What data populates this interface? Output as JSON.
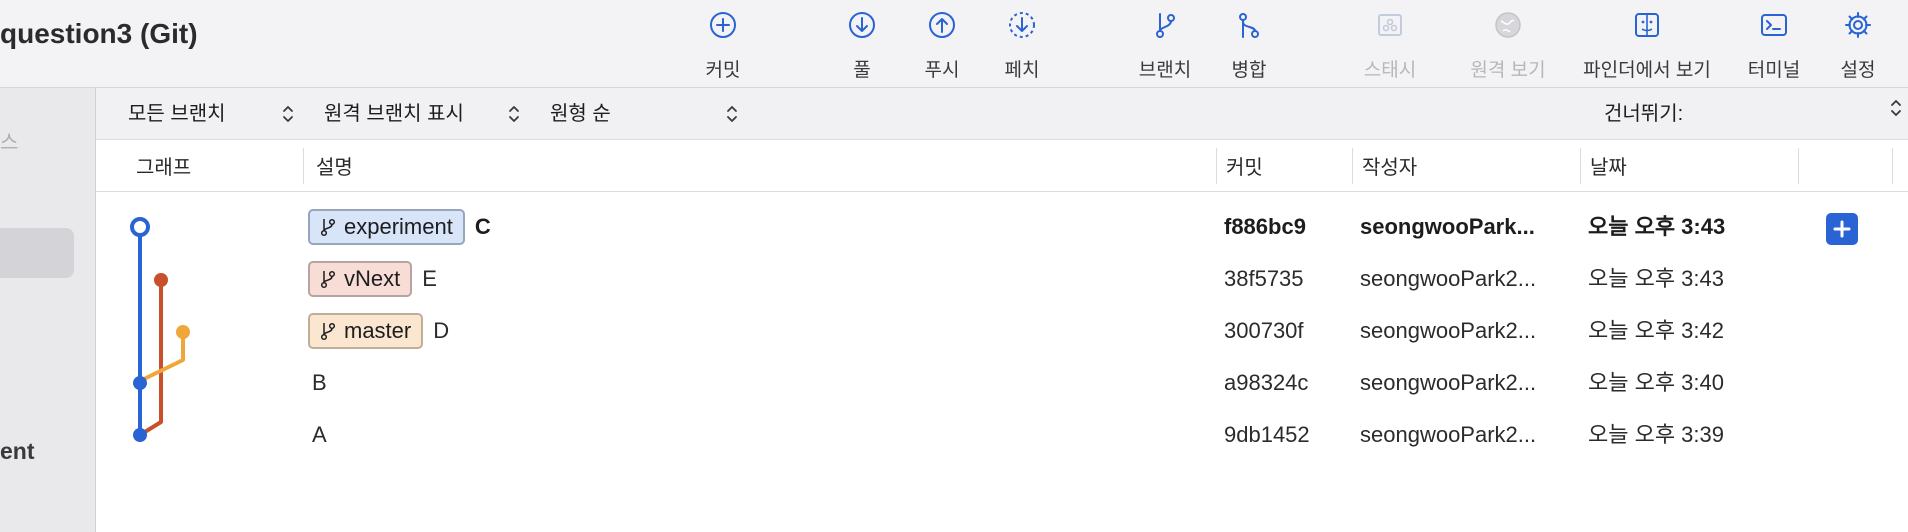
{
  "window": {
    "title": "question3 (Git)"
  },
  "toolbar": {
    "commit": "커밋",
    "pull": "풀",
    "push": "푸시",
    "fetch": "페치",
    "branch": "브랜치",
    "merge": "병합",
    "stash": "스태시",
    "remote_view": "원격 보기",
    "finder_view": "파인더에서 보기",
    "terminal": "터미널",
    "settings": "설정"
  },
  "sidebar": {
    "fragment_top": "스",
    "fragment_bottom": "ent"
  },
  "filters": {
    "branches": "모든 브랜치",
    "remote_branches": "원격 브랜치 표시",
    "order": "원형 순",
    "skip_label": "건너뛰기:"
  },
  "columns": {
    "graph": "그래프",
    "description": "설명",
    "commit": "커밋",
    "author": "작성자",
    "date": "날짜"
  },
  "commits": [
    {
      "branch": "experiment",
      "message": "C",
      "hash": "f886bc9",
      "author": "seongwooPark...",
      "date": "오늘 오후 3:43",
      "bold": true
    },
    {
      "branch": "vNext",
      "message": "E",
      "hash": "38f5735",
      "author": "seongwooPark2...",
      "date": "오늘 오후 3:43",
      "bold": false
    },
    {
      "branch": "master",
      "message": "D",
      "hash": "300730f",
      "author": "seongwooPark2...",
      "date": "오늘 오후 3:42",
      "bold": false
    },
    {
      "branch": "",
      "message": "B",
      "hash": "a98324c",
      "author": "seongwooPark2...",
      "date": "오늘 오후 3:40",
      "bold": false
    },
    {
      "branch": "",
      "message": "A",
      "hash": "9db1452",
      "author": "seongwooPark2...",
      "date": "오늘 오후 3:39",
      "bold": false
    }
  ],
  "colors": {
    "accent": "#2a63d4",
    "lane_main": "#2a63d4",
    "lane_vnext": "#c8502a",
    "lane_master": "#f0a73a",
    "badge_experiment": "#d8e4f8",
    "badge_vnext": "#f8dcd6",
    "badge_master": "#fbe7d0"
  },
  "icons": {
    "commit": "plus-circle-icon",
    "pull": "arrow-down-circle-icon",
    "push": "arrow-up-circle-icon",
    "fetch": "dashed-arrow-down-circle-icon",
    "branch": "branch-icon",
    "merge": "merge-icon",
    "stash": "stash-icon",
    "remote_view": "globe-icon",
    "finder_view": "finder-icon",
    "terminal": "terminal-icon",
    "settings": "gear-icon",
    "add": "plus-icon"
  }
}
